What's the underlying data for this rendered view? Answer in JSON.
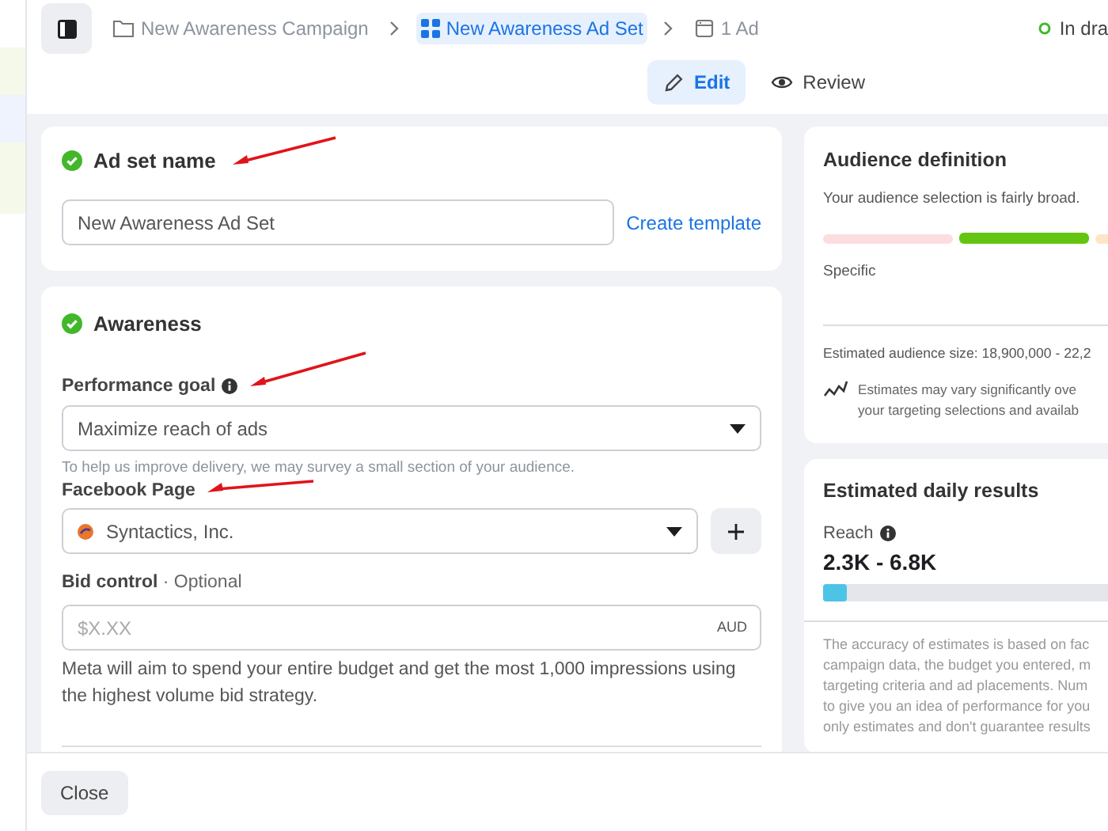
{
  "header": {
    "breadcrumbs": [
      {
        "label": "New Awareness Campaign",
        "kind": "campaign",
        "selected": false
      },
      {
        "label": "New Awareness Ad Set",
        "kind": "adset",
        "selected": true
      },
      {
        "label": "1 Ad",
        "kind": "ad",
        "selected": false
      }
    ],
    "status": "In dra",
    "modes": [
      {
        "label": "Edit",
        "kind": "edit",
        "selected": true
      },
      {
        "label": "Review",
        "kind": "review",
        "selected": false
      }
    ]
  },
  "ad_set_name": {
    "title": "Ad set name",
    "complete": true,
    "annotated": true,
    "value": "New Awareness Ad Set",
    "link": "Create template"
  },
  "awareness": {
    "title": "Awareness",
    "complete": true,
    "performance_goal": {
      "label": "Performance goal",
      "annotated": true,
      "value": "Maximize reach of ads",
      "note": "To help us improve delivery, we may survey a small section of your audience."
    },
    "facebook_page": {
      "label": "Facebook Page",
      "annotated": true,
      "value": "Syntactics, Inc."
    },
    "bid_control": {
      "label": "Bid control",
      "optional": "· Optional",
      "placeholder": "$X.XX",
      "currency": "AUD",
      "description": "Meta will aim to spend your entire budget and get the most 1,000 impressions using the highest volume bid strategy."
    }
  },
  "audience_definition": {
    "title": "Audience definition",
    "summary": "Your audience selection is fairly broad.",
    "segments": [
      {
        "color": "#fbdde0",
        "selected": false
      },
      {
        "color": "#63c512",
        "selected": true
      },
      {
        "color": "#fde6c8",
        "selected": false
      }
    ],
    "scale_label": "Specific",
    "size": "Estimated audience size: 18,900,000 - 22,2",
    "note_lines": [
      "Estimates may vary significantly ove",
      "your targeting selections and availab"
    ]
  },
  "estimated_daily_results": {
    "title": "Estimated daily results",
    "metric": "Reach",
    "range": "2.3K - 6.8K",
    "level": 0.07,
    "disclaimer_lines": [
      "The accuracy of estimates is based on fac",
      "campaign data, the budget you entered, m",
      "targeting criteria and ad placements. Num",
      "to give you an idea of performance for you",
      "only estimates and don't guarantee results"
    ]
  },
  "footer": {
    "buttons": [
      "Close"
    ]
  }
}
